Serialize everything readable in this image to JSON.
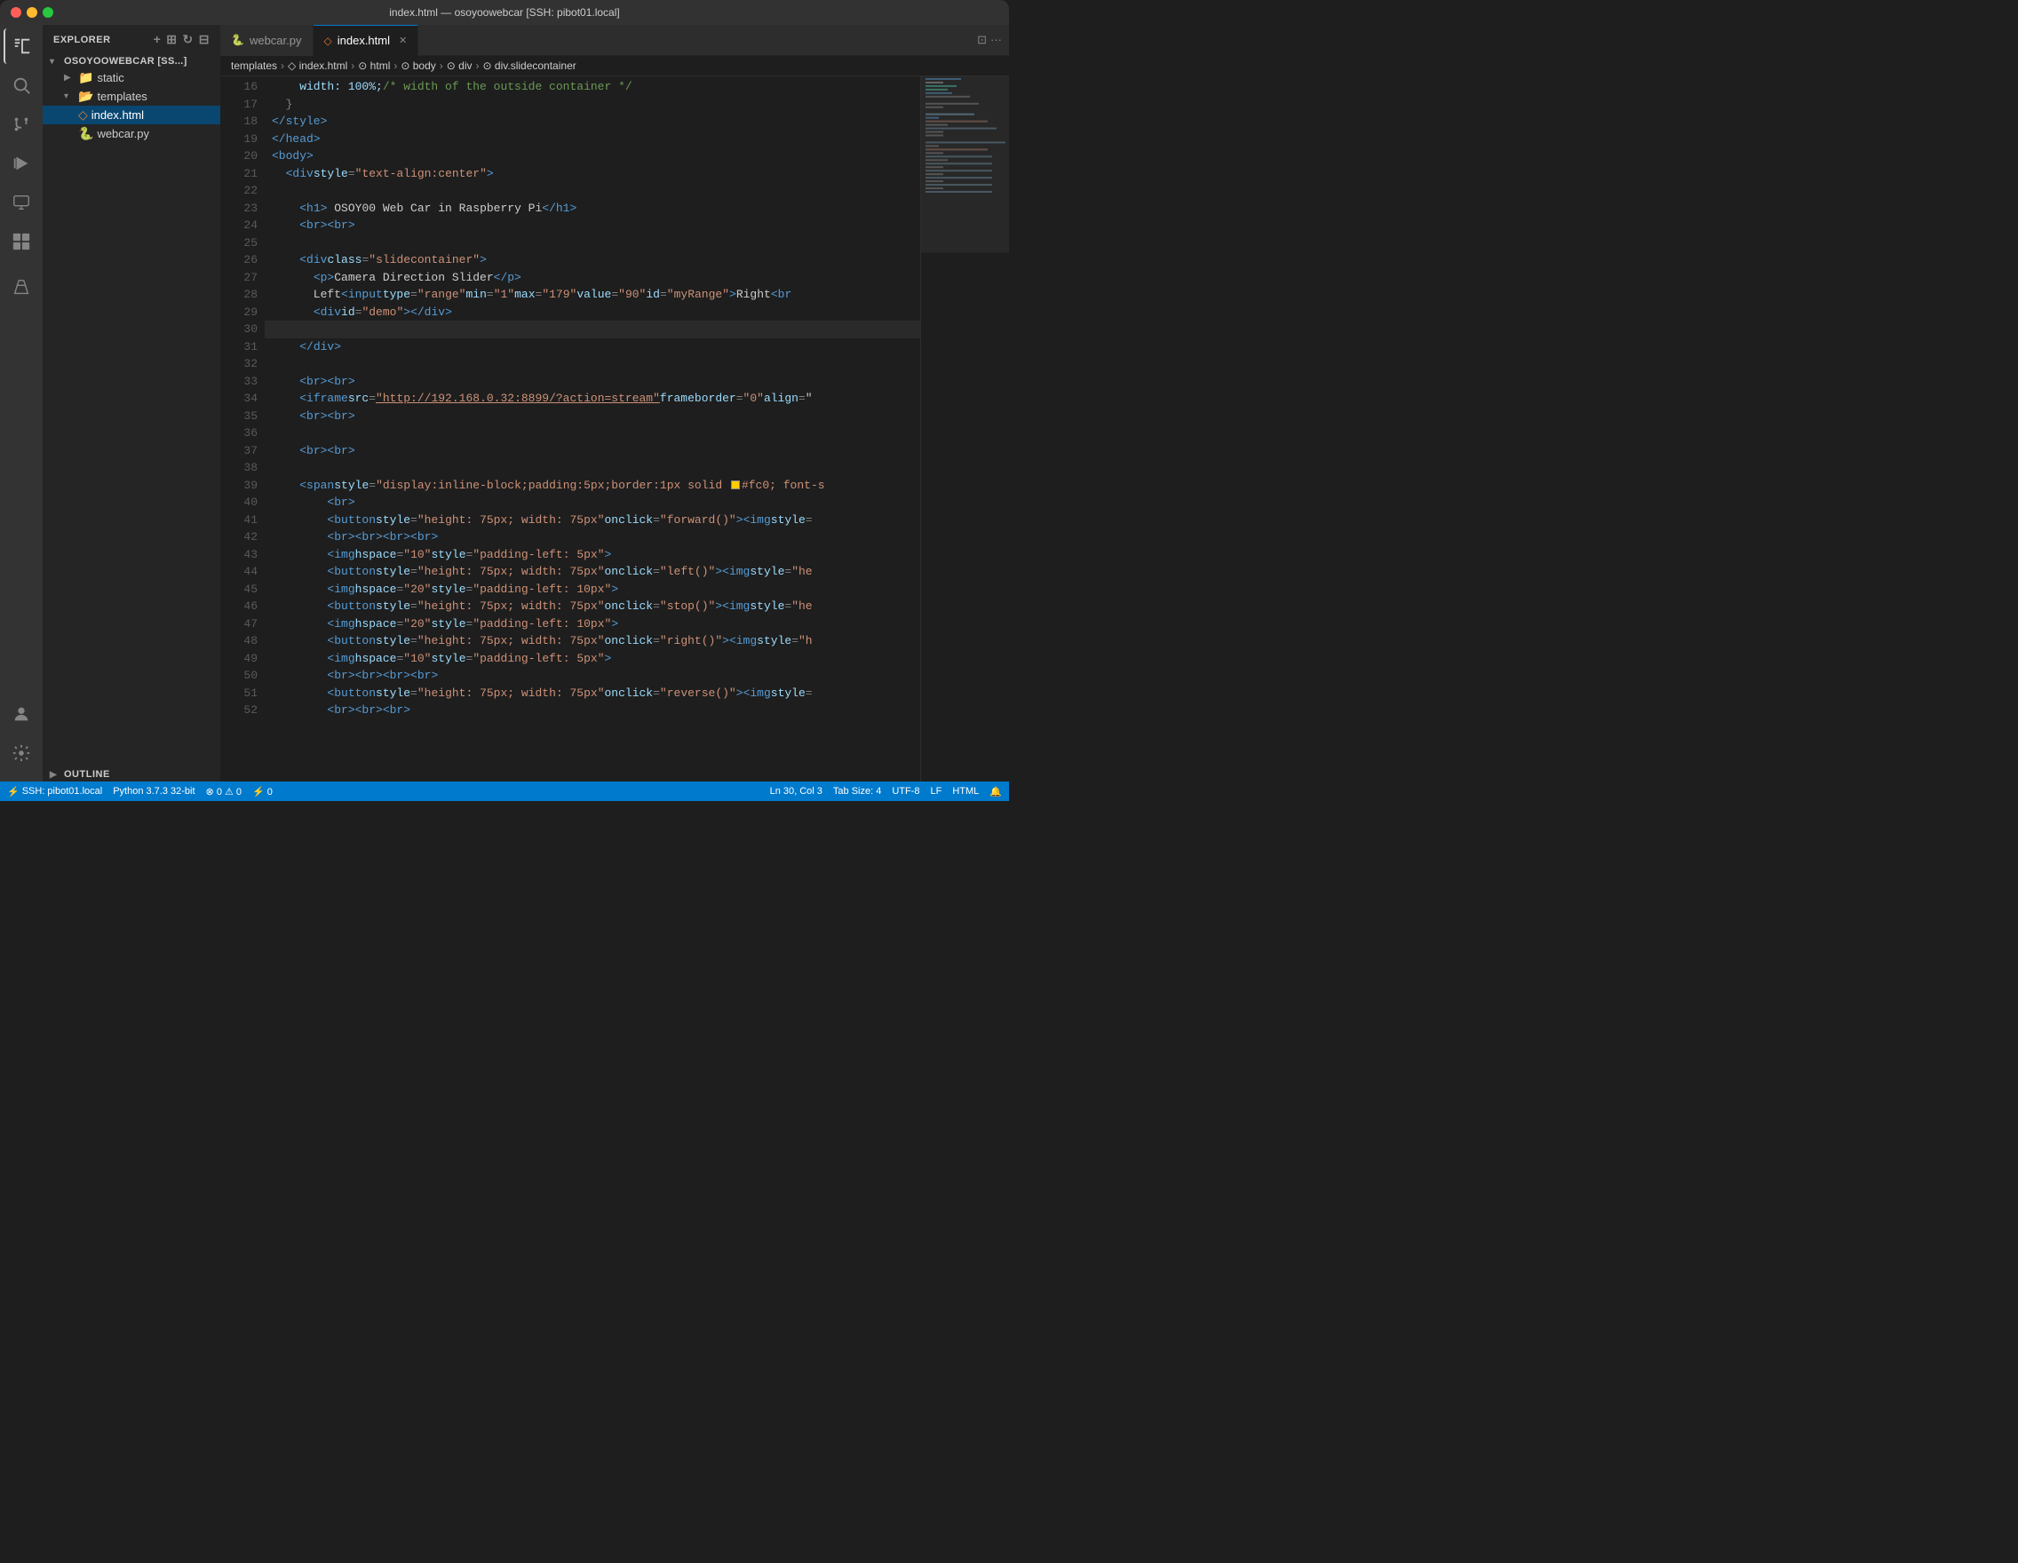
{
  "titlebar": {
    "title": "index.html — osoyoowebcar [SSH: pibot01.local]"
  },
  "tabs": [
    {
      "label": "webcar.py",
      "icon": "🐍",
      "active": false,
      "modified": false
    },
    {
      "label": "index.html",
      "icon": "◇",
      "active": true,
      "modified": false,
      "closeable": true
    }
  ],
  "breadcrumb": {
    "items": [
      "templates",
      "<> index.html",
      "⊙ html",
      "⊙ body",
      "⊙ div",
      "⊙ div.slidecontainer"
    ]
  },
  "sidebar": {
    "header": "EXPLORER",
    "root": {
      "label": "OSOYOOWEBCAR [SS...]",
      "children": [
        {
          "label": "static",
          "type": "folder",
          "expanded": false
        },
        {
          "label": "templates",
          "type": "folder",
          "expanded": true,
          "children": [
            {
              "label": "index.html",
              "type": "html",
              "active": true
            },
            {
              "label": "webcar.py",
              "type": "python"
            }
          ]
        }
      ]
    },
    "outline": "OUTLINE"
  },
  "code_lines": [
    {
      "num": 16,
      "content": "    width: 100%; /* width of the outside container */",
      "type": "comment"
    },
    {
      "num": 17,
      "content": "  }"
    },
    {
      "num": 18,
      "content": "</style>"
    },
    {
      "num": 19,
      "content": "</head>"
    },
    {
      "num": 20,
      "content": "<body>"
    },
    {
      "num": 21,
      "content": "  <div style=\"text-align:center\">"
    },
    {
      "num": 22,
      "content": ""
    },
    {
      "num": 23,
      "content": "    <h1> OSOY00 Web Car in Raspberry Pi</h1>"
    },
    {
      "num": 24,
      "content": "    <br><br>"
    },
    {
      "num": 25,
      "content": ""
    },
    {
      "num": 26,
      "content": "    <div class=\"slidecontainer\">"
    },
    {
      "num": 27,
      "content": "      <p>Camera Direction Slider</p>"
    },
    {
      "num": 28,
      "content": "      Left<input type=\"range\" min=\"1\" max=\"179\" value=\"90\" id=\"myRange\">Right<br>"
    },
    {
      "num": 29,
      "content": "      <div id=\"demo\"></div>"
    },
    {
      "num": 30,
      "content": "    ",
      "cursor": true
    },
    {
      "num": 31,
      "content": "    </div>"
    },
    {
      "num": 32,
      "content": ""
    },
    {
      "num": 33,
      "content": "    <br><br>"
    },
    {
      "num": 34,
      "content": "    <iframe src=\"http://192.168.0.32:8899/?action=stream\" frameborder=\"0\" align=\""
    },
    {
      "num": 35,
      "content": "    <br><br>"
    },
    {
      "num": 36,
      "content": ""
    },
    {
      "num": 37,
      "content": "    <br><br>"
    },
    {
      "num": 38,
      "content": ""
    },
    {
      "num": 39,
      "content": "    <span style=\"display:inline-block;padding:5px;border:1px solid ■#fc0; font-s"
    },
    {
      "num": 40,
      "content": "        <br>"
    },
    {
      "num": 41,
      "content": "        <button style=\"height: 75px; width: 75px\" onclick=\"forward()\"><img style="
    },
    {
      "num": 42,
      "content": "        <br><br><br><br>"
    },
    {
      "num": 43,
      "content": "        <img hspace=\"10\" style=\"padding-left: 5px\">"
    },
    {
      "num": 44,
      "content": "        <button style=\"height: 75px; width: 75px\" onclick=\"left()\"><img style=\"he"
    },
    {
      "num": 45,
      "content": "        <img hspace=\"20\" style=\"padding-left: 10px\">"
    },
    {
      "num": 46,
      "content": "        <button style=\"height: 75px; width: 75px\" onclick=\"stop()\"><img style=\"he"
    },
    {
      "num": 47,
      "content": "        <img hspace=\"20\" style=\"padding-left: 10px\">"
    },
    {
      "num": 48,
      "content": "        <button style=\"height: 75px; width: 75px\" onclick=\"right()\"><img style=\"h"
    },
    {
      "num": 49,
      "content": "        <img hspace=\"10\" style=\"padding-left: 5px\">"
    },
    {
      "num": 50,
      "content": "        <br><br><br><br>"
    },
    {
      "num": 51,
      "content": "        <button style=\"height: 75px; width: 75px\" onclick=\"reverse()\"><img style="
    },
    {
      "num": 52,
      "content": "        <br><br><br>"
    }
  ],
  "status_bar": {
    "ssh": "SSH: pibot01.local",
    "python": "Python 3.7.3 32-bit",
    "errors": "⊗ 0",
    "warnings": "⚠ 0",
    "remote": "⚡ 0",
    "cursor": "Ln 30, Col 3",
    "tab_size": "Tab Size: 4",
    "encoding": "UTF-8",
    "line_ending": "LF",
    "language": "HTML",
    "feedback": "🔔"
  }
}
